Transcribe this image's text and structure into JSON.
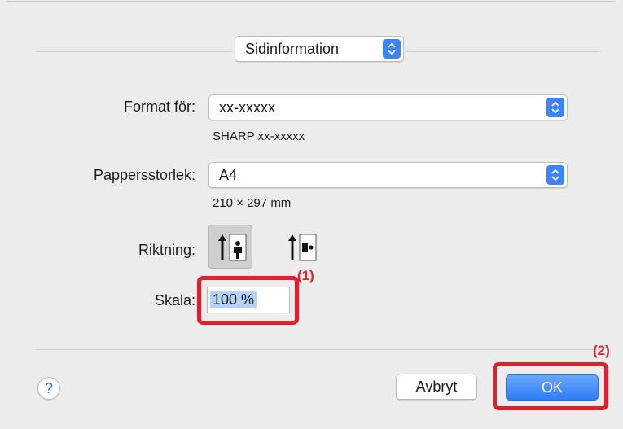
{
  "section_popup": {
    "label": "Sidinformation"
  },
  "format": {
    "label": "Format för:",
    "value": "xx-xxxxx",
    "sublabel": "SHARP xx-xxxxx"
  },
  "paper": {
    "label": "Pappersstorlek:",
    "value": "A4",
    "dimensions": "210 × 297 mm"
  },
  "orientation": {
    "label": "Riktning:",
    "selected": "portrait"
  },
  "scale": {
    "label": "Skala:",
    "value": "100 %"
  },
  "annotations": {
    "one": "(1)",
    "two": "(2)"
  },
  "buttons": {
    "help": "?",
    "cancel": "Avbryt",
    "ok": "OK"
  },
  "colors": {
    "accent": "#3d84f7",
    "annotation": "#e0202e",
    "selection": "#b3d3fb"
  },
  "icons": {
    "popup_stepper": "up-down-chevron-icon",
    "portrait": "portrait-orientation-icon",
    "landscape": "landscape-orientation-icon"
  }
}
